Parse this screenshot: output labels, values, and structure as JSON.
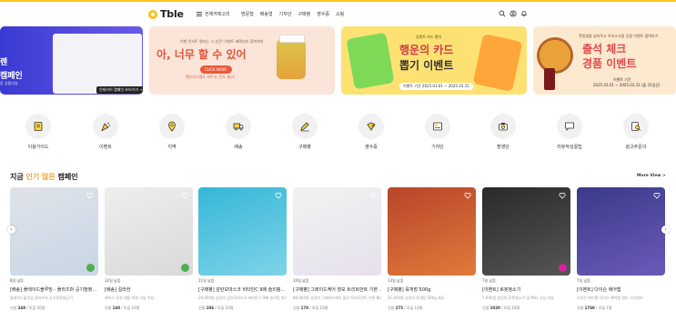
{
  "header": {
    "logo_text": "Tble",
    "category_button": "전체카테고리",
    "nav": [
      "방문형",
      "배송형",
      "기자단",
      "구매평",
      "영수증",
      "쇼핑"
    ],
    "icons": [
      "search-icon",
      "user-icon",
      "bell-icon"
    ]
  },
  "banners": [
    {
      "line1": "렌",
      "line2": "캠페인",
      "line3": "등 상품리뷰",
      "cta": "인테리어 캠페인 보러가기 →"
    },
    {
      "sub": "이젠 콘서트 열리는 그 순간! 이벤트 혜택부터 참여까지",
      "head": "아, 너무 할 수 있어",
      "pill": "CLICK NOW!",
      "small": "렌스터그램도 저우고, 돈도 벌고!"
    },
    {
      "sub": "일렌트 카드 뽑기",
      "head1": "행운의 카드",
      "head2": "뽑기 이벤트",
      "date": "이벤트 기간 2025.03.01 ~ 2025.03.31"
    },
    {
      "sub": "학원생을 넘어주고 아이스크림 당첨 이벤트 참여하기",
      "head1": "출석 체크",
      "head2": "경품 이벤트",
      "date1": "이벤트 기간",
      "date2": "2025.03.01 ~ 2025.03.31 (출 31일간)"
    }
  ],
  "categories": [
    {
      "label": "이용가이드",
      "icon": "guide-icon"
    },
    {
      "label": "이벤트",
      "icon": "party-icon"
    },
    {
      "label": "지역",
      "icon": "map-pin-icon"
    },
    {
      "label": "배송",
      "icon": "truck-icon"
    },
    {
      "label": "구매평",
      "icon": "pen-icon"
    },
    {
      "label": "영수증",
      "icon": "receipt-icon"
    },
    {
      "label": "기자단",
      "icon": "news-icon"
    },
    {
      "label": "촬영단",
      "icon": "camera-icon"
    },
    {
      "label": "리뷰작성꿀팁",
      "icon": "chat-icon"
    },
    {
      "label": "광고주문의",
      "icon": "search-doc-icon"
    }
  ],
  "section": {
    "title_prefix": "지금 ",
    "title_highlight": "인기 많은",
    "title_suffix": " 캠페인",
    "more": "More View >"
  },
  "campaigns": [
    {
      "meta": "8일 남음",
      "title": "[배송] 플레이드블루밍 - 플라즈마 공기청정...",
      "desc": "플레이드블루밍 플라즈마 공기청정살균기",
      "stat_prefix": "신청 ",
      "stat_value": "248",
      "stat_suffix": " / 모집 50명",
      "colors": [
        "#dfe3e8",
        "#c8d6e6"
      ],
      "badge": "#4caf50"
    },
    {
      "meta": "12일 남음",
      "title": "[배송] 길라한",
      "desc": "케이스 증정 제품 착용 리뷰 작성",
      "stat_prefix": "신청 ",
      "stat_value": "140",
      "stat_suffix": " / 모집 10명",
      "colors": [
        "#eeeeee",
        "#d9d9d9"
      ],
      "badge": "#4caf50"
    },
    {
      "meta": "11일 남음",
      "title": "[구매평] 감탄모마스크 비타민C 9매 슬리핑...",
      "desc": "20,000원 상당의 감탄모마스크 비타민 C 9매 슬리핑 마스크",
      "stat_prefix": "신청 ",
      "stat_value": "106",
      "stat_suffix": " / 모집 10명",
      "colors": [
        "#36b7d8",
        "#7fd3e8"
      ],
      "badge": ""
    },
    {
      "meta": "10일 남음",
      "title": "[구매평] 그레이드케어 힐모 트리트먼트 기본 ...",
      "desc": "86,000원 상당의 그레이드케어 힐모 트리트먼트 기본 패키지",
      "stat_prefix": "신청 ",
      "stat_value": "170",
      "stat_suffix": " / 모집 10명",
      "colors": [
        "#f2f2f2",
        "#e6e0ec"
      ],
      "badge": ""
    },
    {
      "meta": "13일 남음",
      "title": "[구매평] 육개장 500g",
      "desc": "21,000원 상당의 육개장 500g 제공",
      "stat_prefix": "신청 ",
      "stat_value": "275",
      "stat_suffix": " / 모집 10명",
      "colors": [
        "#b8452a",
        "#e07a3a"
      ],
      "badge": ""
    },
    {
      "meta": "7일 남음",
      "title": "[이벤트] 로봇청소기",
      "desc": "7,000원 상당의 로봇청소기 및 Mini 기능 리뷰",
      "stat_prefix": "신청 ",
      "stat_value": "1020",
      "stat_suffix": " / 모집 10명",
      "colors": [
        "#2a2a2a",
        "#555555"
      ],
      "badge": "#d6249f"
    },
    {
      "meta": "7일 남음",
      "title": "[이벤트] 다이슨 에어랩",
      "desc": "다이슨 에어랩 다이슨 에어랩 멀티 스타일러",
      "stat_prefix": "신청 ",
      "stat_value": "1768",
      "stat_suffix": " / 모집 1명",
      "colors": [
        "#3a3a8a",
        "#6a5ab8"
      ],
      "badge": ""
    }
  ]
}
